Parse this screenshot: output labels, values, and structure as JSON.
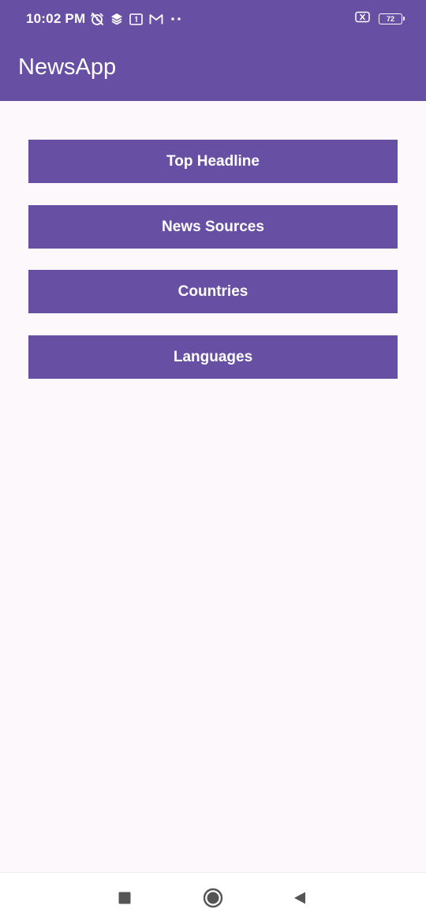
{
  "status_bar": {
    "time": "10:02 PM",
    "battery_level": "72",
    "icons": [
      "alarm-off-icon",
      "layers-icon",
      "calendar-icon",
      "gmail-icon",
      "more-dots-icon",
      "sim-off-icon",
      "battery-icon"
    ]
  },
  "app_bar": {
    "title": "NewsApp"
  },
  "menu": {
    "items": [
      {
        "label": "Top Headline"
      },
      {
        "label": "News Sources"
      },
      {
        "label": "Countries"
      },
      {
        "label": "Languages"
      }
    ]
  },
  "nav_bar": {
    "icons": [
      "recents-square-icon",
      "home-circle-icon",
      "back-triangle-icon"
    ]
  },
  "colors": {
    "primary": "#6750a4",
    "background": "#fdf8fc",
    "on_primary": "#ffffff"
  }
}
